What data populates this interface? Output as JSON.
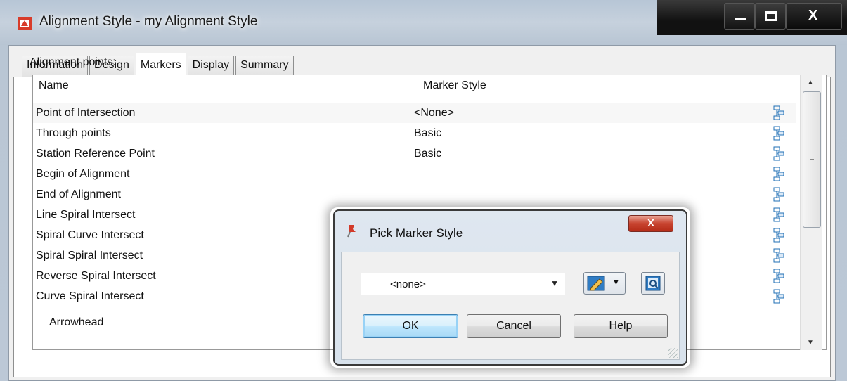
{
  "window": {
    "title": "Alignment Style - my Alignment Style",
    "controls": [
      "minimize-icon",
      "maximize-icon",
      "close-icon"
    ],
    "close_glyph": "X"
  },
  "tabs": [
    {
      "label": "Information"
    },
    {
      "label": "Design"
    },
    {
      "label": "Markers",
      "active": true
    },
    {
      "label": "Display"
    },
    {
      "label": "Summary"
    }
  ],
  "markers": {
    "group_label": "Alignment points:",
    "columns": {
      "name": "Name",
      "marker_style": "Marker Style"
    },
    "rows": [
      {
        "name": "Point of Intersection",
        "style": "<None>"
      },
      {
        "name": "Through points",
        "style": "Basic"
      },
      {
        "name": "Station Reference Point",
        "style": "Basic"
      },
      {
        "name": "Begin of Alignment",
        "style": ""
      },
      {
        "name": "End of Alignment",
        "style": ""
      },
      {
        "name": "Line Spiral Intersect",
        "style": ""
      },
      {
        "name": "Spiral Curve Intersect",
        "style": ""
      },
      {
        "name": "Spiral Spiral Intersect",
        "style": ""
      },
      {
        "name": "Reverse Spiral Intersect",
        "style": ""
      },
      {
        "name": "Curve Spiral Intersect",
        "style": ""
      }
    ],
    "arrowhead_label": "Arrowhead"
  },
  "dialog": {
    "title": "Pick Marker Style",
    "close_glyph": "X",
    "combo_value": "<none>",
    "ok_label": "OK",
    "cancel_label": "Cancel",
    "help_label": "Help"
  },
  "colors": {
    "ok_button_border": "#3c7fb1",
    "close_button": "#c7432f",
    "icon_blue": "#1f6fb5"
  }
}
